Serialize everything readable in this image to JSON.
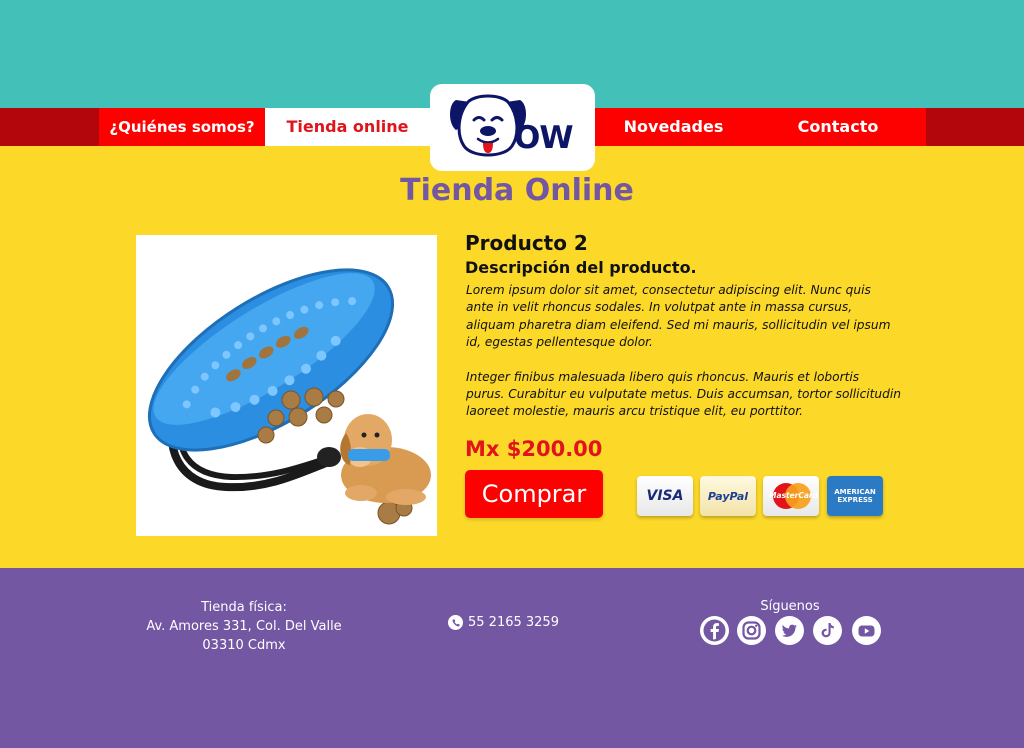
{
  "nav": {
    "about": "¿Quiénes somos?",
    "shop": "Tienda online",
    "news": "Novedades",
    "contact": "Contacto"
  },
  "logo": {
    "text": "OW"
  },
  "page": {
    "title": "Tienda Online"
  },
  "product": {
    "name": "Producto 2",
    "subtitle": "Descripción del producto.",
    "paragraph1": "Lorem ipsum dolor sit amet, consectetur adipiscing elit. Nunc quis ante in velit rhoncus sodales. In volutpat ante in massa cursus, aliquam pharetra diam eleifend. Sed mi mauris, sollicitudin vel ipsum id, egestas pellentesque dolor.",
    "paragraph2": "Integer finibus malesuada libero quis rhoncus. Mauris et lobortis purus. Curabitur eu vulputate metus. Duis accumsan, tortor sollicitudin laoreet molestie, mauris arcu tristique elit, eu porttitor.",
    "price": "Mx $200.00",
    "buy_label": "Comprar"
  },
  "payments": {
    "visa": "VISA",
    "paypal": "PayPal",
    "mastercard": "MasterCard",
    "amex_line1": "AMERICAN",
    "amex_line2": "EXPRESS"
  },
  "footer": {
    "store_label": "Tienda física:",
    "address_line1": "Av. Amores 331, Col. Del Valle",
    "address_line2": "03310 Cdmx",
    "phone": "55 2165 3259",
    "follow_label": "Síguenos",
    "social_icons": [
      "facebook-icon",
      "instagram-icon",
      "twitter-icon",
      "tiktok-icon",
      "youtube-icon"
    ]
  },
  "colors": {
    "teal": "#43c0b7",
    "red": "#fd0000",
    "dark_red": "#b3050c",
    "yellow": "#fcd829",
    "purple": "#7357a3",
    "navy": "#0d1666"
  }
}
